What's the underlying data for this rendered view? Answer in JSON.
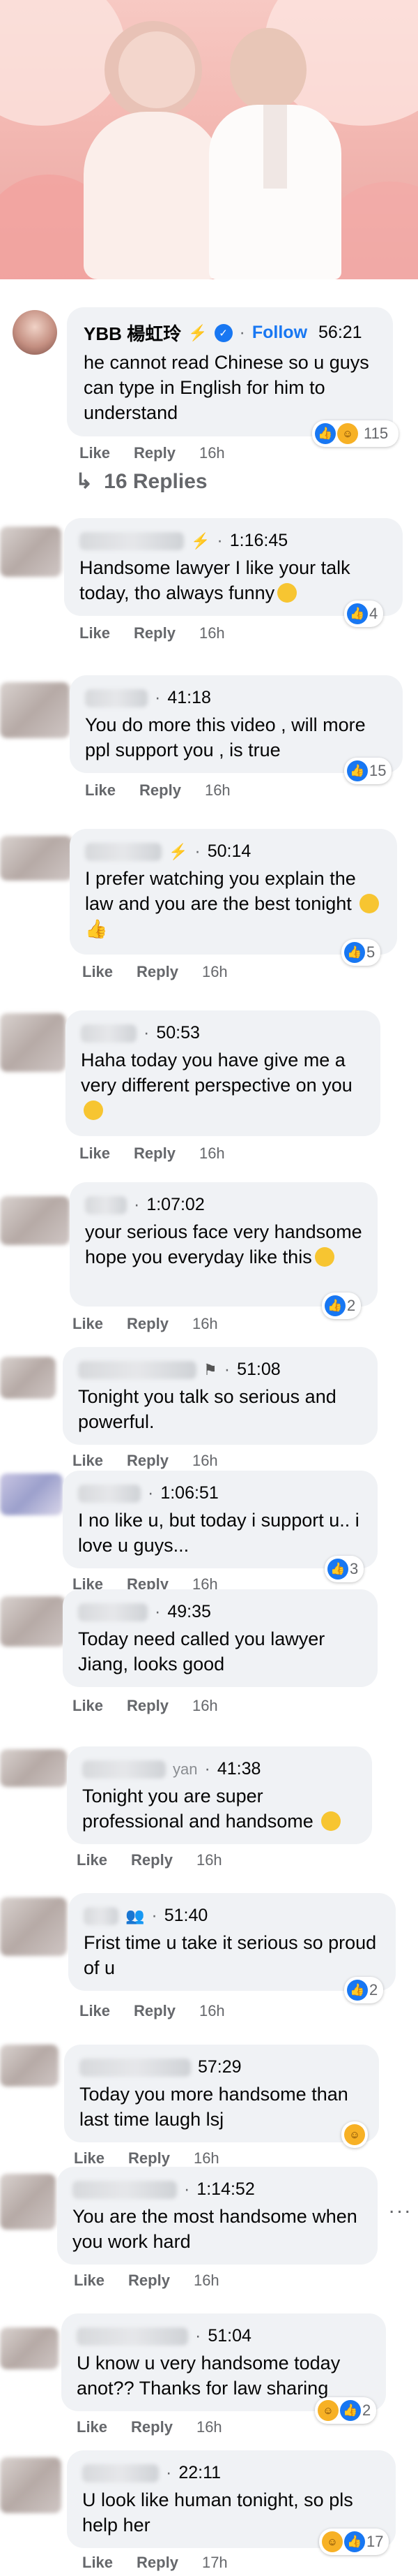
{
  "hero": {
    "alt": "wedding photo"
  },
  "top_comment": {
    "name": "YBB 楊虹玲",
    "follow_label": "Follow",
    "timestamp": "56:21",
    "text": "he cannot read Chinese so u guys can type in English for him to understand",
    "like_label": "Like",
    "reply_label": "Reply",
    "time": "16h",
    "reactions": "115",
    "replies_label": "16 Replies"
  },
  "comments": [
    {
      "ts": "1:16:45",
      "text": "Handsome lawyer I like your talk today, tho always funny",
      "time": "16h",
      "react": "4"
    },
    {
      "ts": "41:18",
      "text": "You do more this video , will more ppl support you , is true",
      "time": "16h",
      "react": "15"
    },
    {
      "ts": "50:14",
      "text": "I prefer watching you explain the law and you are the best tonight",
      "time": "16h",
      "react": "5"
    },
    {
      "ts": "50:53",
      "text": "Haha today you have give me a very different perspective on you",
      "time": "16h",
      "react": ""
    },
    {
      "ts": "1:07:02",
      "text": "your serious face very handsome hope you everyday like this",
      "time": "16h",
      "react": "2"
    },
    {
      "ts": "51:08",
      "text": "Tonight you talk so serious and powerful.",
      "time": "16h",
      "react": ""
    },
    {
      "ts": "1:06:51",
      "text": "I no like u, but today i support u.. i love u guys...",
      "time": "16h",
      "react": "3"
    },
    {
      "ts": "49:35",
      "text": "Today need called you lawyer Jiang, looks good",
      "time": "16h",
      "react": ""
    },
    {
      "ts": "41:38",
      "name_tail": "yan",
      "text": "Tonight you are super professional and handsome",
      "time": "16h",
      "react": ""
    },
    {
      "ts": "51:40",
      "text": "Frist time u take it serious so proud of u",
      "time": "16h",
      "react": "2"
    },
    {
      "ts": "57:29",
      "text": "Today you more handsome than last time laugh lsj",
      "time": "16h",
      "react": ""
    },
    {
      "ts": "1:14:52",
      "text": "You are the most handsome when you work hard",
      "time": "16h",
      "react": ""
    },
    {
      "ts": "51:04",
      "text": "U know u very handsome today anot?? Thanks for law sharing",
      "time": "16h",
      "react": "2"
    },
    {
      "ts": "22:11",
      "text": "U look like human tonight, so pls help her",
      "time": "17h",
      "react": "17"
    }
  ],
  "labels": {
    "like": "Like",
    "reply": "Reply",
    "more": "..."
  },
  "colors": {
    "accent": "#1877f2",
    "bubble": "#f0f2f5",
    "meta": "#65676b"
  }
}
